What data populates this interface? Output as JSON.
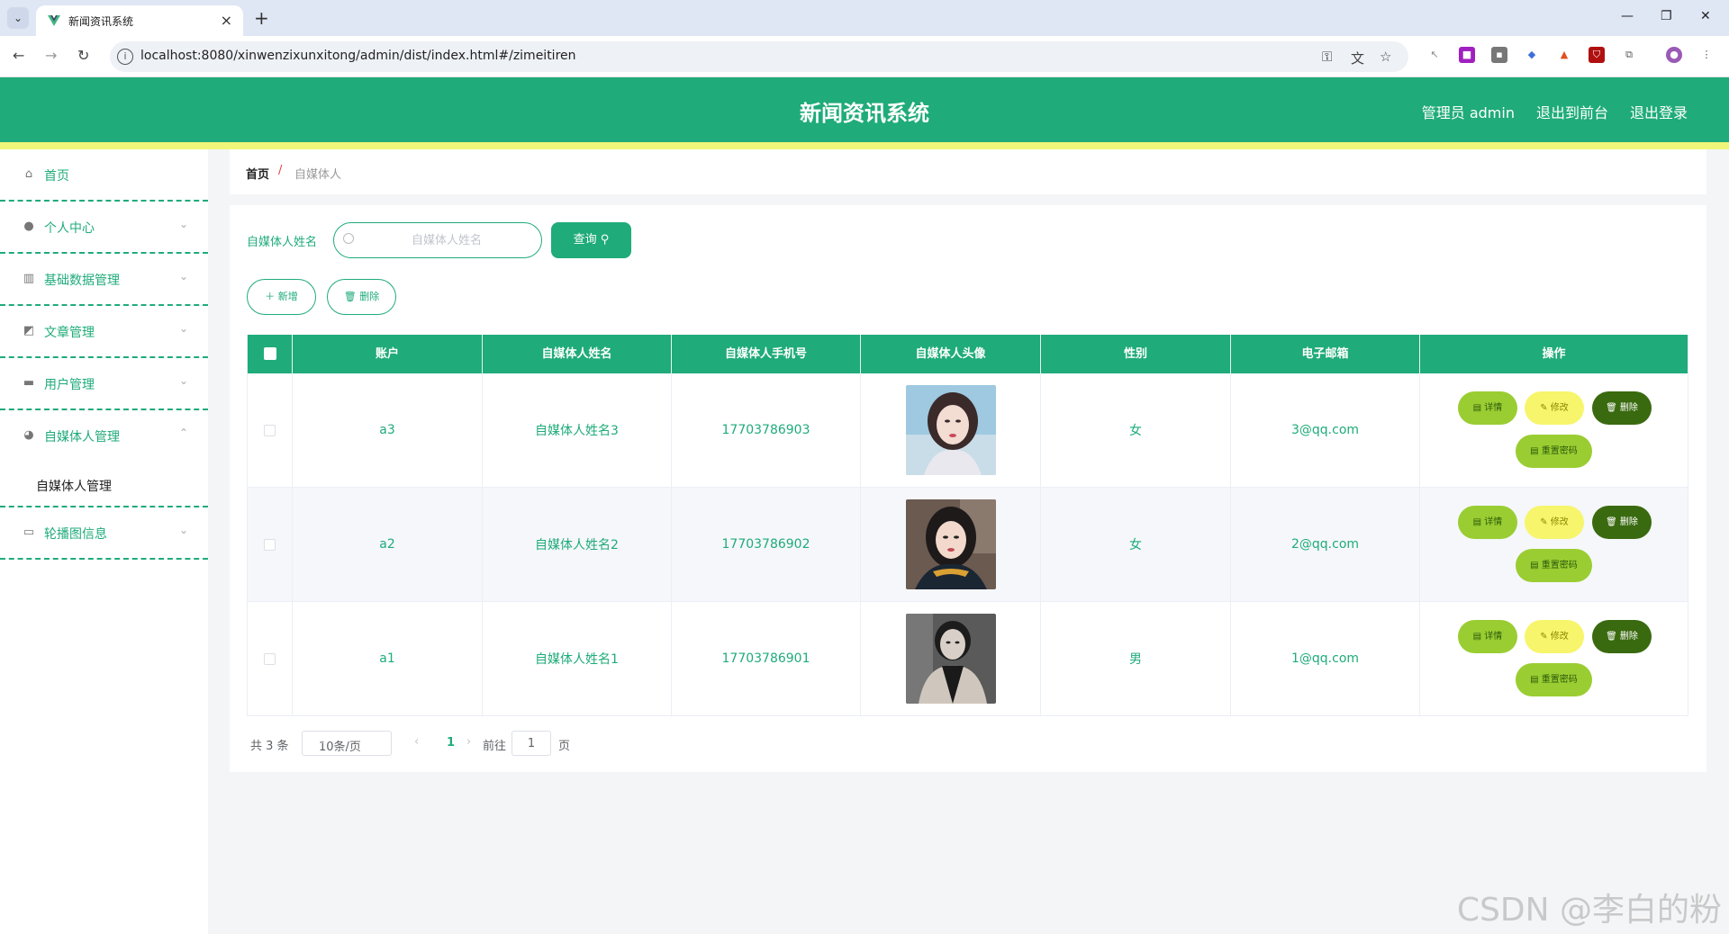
{
  "browser": {
    "tab_title": "新闻资讯系统",
    "url": "localhost:8080/xinwenzixunxitong/admin/dist/index.html#/zimeitiren"
  },
  "header": {
    "title": "新闻资讯系统",
    "links": [
      "管理员 admin",
      "退出到前台",
      "退出登录"
    ],
    "accent": "#1fab7a"
  },
  "sidebar": {
    "items": [
      {
        "label": "首页",
        "icon": "home-icon"
      },
      {
        "label": "个人中心",
        "icon": "user-icon"
      },
      {
        "label": "基础数据管理",
        "icon": "chart-icon"
      },
      {
        "label": "文章管理",
        "icon": "trend-icon"
      },
      {
        "label": "用户管理",
        "icon": "message-icon"
      },
      {
        "label": "自媒体人管理",
        "icon": "bulb-icon"
      },
      {
        "label": "轮播图信息",
        "icon": "picture-icon"
      }
    ],
    "sub_item": "自媒体人管理"
  },
  "breadcrumb": {
    "home": "首页",
    "separator": "/",
    "current": "自媒体人"
  },
  "search": {
    "label": "自媒体人姓名",
    "placeholder": "自媒体人姓名",
    "query_label": "查询 ⚲"
  },
  "actions": {
    "add_label": "＋ 新增",
    "delete_label": "🗑 删除"
  },
  "table": {
    "headers": [
      "",
      "账户",
      "自媒体人姓名",
      "自媒体人手机号",
      "自媒体人头像",
      "性别",
      "电子邮箱",
      "操作"
    ],
    "rows": [
      {
        "account": "a3",
        "name": "自媒体人姓名3",
        "phone": "17703786903",
        "gender": "女",
        "email": "3@qq.com"
      },
      {
        "account": "a2",
        "name": "自媒体人姓名2",
        "phone": "17703786902",
        "gender": "女",
        "email": "2@qq.com"
      },
      {
        "account": "a1",
        "name": "自媒体人姓名1",
        "phone": "17703786901",
        "gender": "男",
        "email": "1@qq.com"
      }
    ],
    "row_actions": {
      "detail": "▤ 详情",
      "edit": "✎ 修改",
      "delete": "🗑 删除",
      "reset": "▤ 重置密码"
    }
  },
  "pagination": {
    "total": "共 3 条",
    "page_size": "10条/页",
    "current": "1",
    "goto_label": "前往",
    "goto_value": "1",
    "unit": "页"
  },
  "watermark": "CSDN @李白的粉"
}
